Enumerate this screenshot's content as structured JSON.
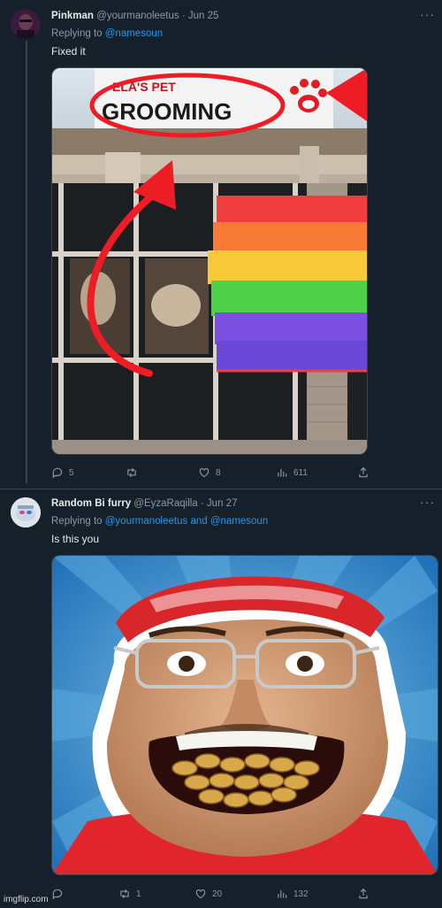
{
  "tweet1": {
    "name": "Pinkman",
    "handle": "@yourmanoleetus",
    "date": "· Jun 25",
    "replying_prefix": "Replying to",
    "replying_to": "@namesoun",
    "text": "Fixed it",
    "image": {
      "sign_top": "ELA'S PET",
      "sign_main": "GROOMING"
    },
    "actions": {
      "replies": "5",
      "retweets": "",
      "likes": "8",
      "views": "611"
    }
  },
  "tweet2": {
    "name": "Random Bi furry",
    "handle": "@EyzaRaqilla",
    "date": "· Jun 27",
    "replying_prefix": "Replying to",
    "replying_to": "@yourmanoleetus and @namesoun",
    "text": "Is this you",
    "actions": {
      "replies": "",
      "retweets": "1",
      "likes": "20",
      "views": "132"
    }
  },
  "more_label": "···",
  "watermark": "imgflip.com",
  "colors": {
    "background": "#15202b",
    "link": "#1d9bf0",
    "muted": "#8b98a5",
    "border": "#38444d"
  }
}
